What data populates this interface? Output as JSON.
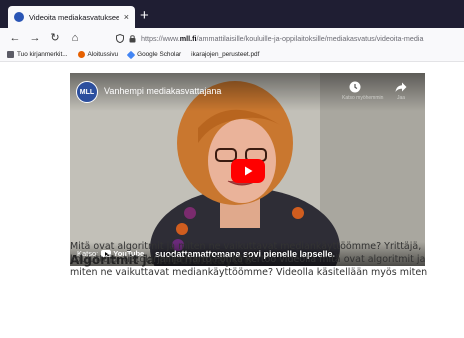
{
  "browser": {
    "tab_title": "Videoita mediakasvatukseen",
    "tab_close": "×",
    "new_tab": "+",
    "url_prefix": "https://www.",
    "url_domain": "mll.fi",
    "url_path": "/ammattilaisille/kouluille-ja-oppilaitoksille/mediakasvatus/videoita-media",
    "bookmarks": [
      {
        "label": "Tuo kirjanmerkit...",
        "icon": "import-icon",
        "color": "#5c5c66"
      },
      {
        "label": "Aloitussivu",
        "icon": "firefox-icon",
        "color": "#e66000"
      },
      {
        "label": "Google Scholar",
        "icon": "scholar-icon",
        "color": "#4285f4"
      },
      {
        "label": "ikarajojen_perusteet.pdf",
        "icon": "",
        "color": ""
      }
    ]
  },
  "video": {
    "channel_logo": "MLL",
    "title": "Vanhempi mediakasvattajana",
    "watch_later_label": "Katso myöhemmin",
    "share_label": "Jaa",
    "watch_on_label": "Katso:",
    "youtube_label": "YouTube",
    "caption": "suodattamattomana sovi pienelle lapselle."
  },
  "article": {
    "heading": "Algoritmit ja mediankäyttö",
    "paragraph": "Mitä ovat algoritmit ja miten ne vaikuttavat mediankäyttöömme? Yrittäjä, kouluttaja, tietokirjailija Harto Pönkä kertoo videolla mitä ovat algoritmit ja miten ne vaikuttavat mediankäyttöömme? Videolla käsitellään myös miten"
  },
  "colors": {
    "tabstrip": "#1f1e33",
    "toolbar": "#f9f9fb",
    "play_button": "#ff0000",
    "mll_blue": "#2c4f9e"
  }
}
